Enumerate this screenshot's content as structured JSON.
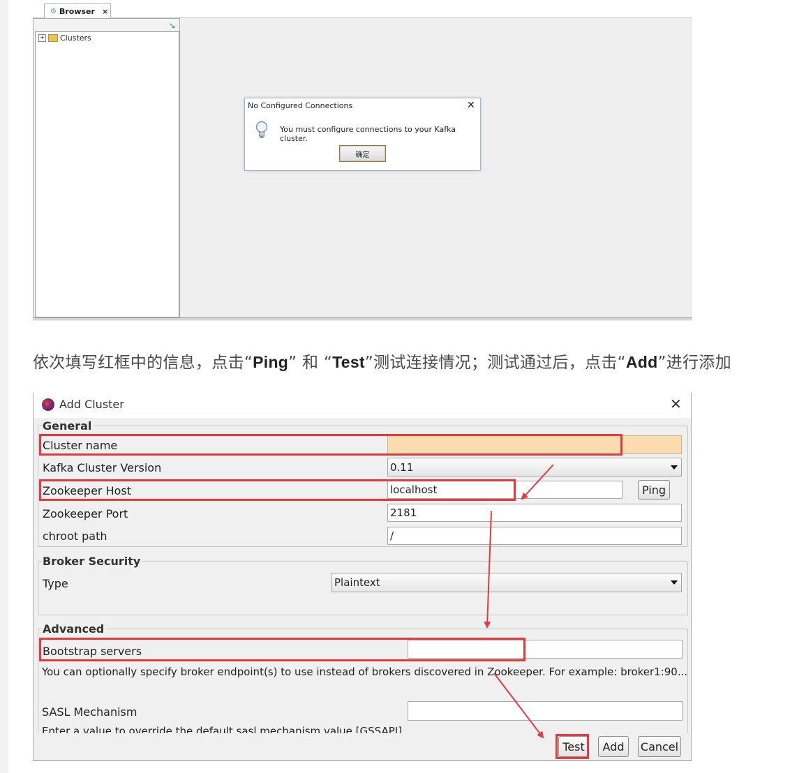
{
  "browser_window": {
    "tab_label": "Browser",
    "tab_close": "×",
    "tree_root": "Clusters",
    "tree_expand": "+",
    "dialog": {
      "title": "No Configured Connections",
      "close": "✕",
      "message": "You must configure connections to your Kafka cluster.",
      "ok_button": "确定"
    }
  },
  "caption": {
    "part1": "依次填写红框中的信息，点击“",
    "ping": "Ping",
    "part2": "” 和 “",
    "test": "Test",
    "part3": "”测试连接情况；测试通过后，点击“",
    "add": "Add",
    "part4": "”进行添加"
  },
  "add_cluster": {
    "title": "Add Cluster",
    "close": "✕",
    "general": {
      "legend": "General",
      "cluster_name_label": "Cluster name",
      "cluster_name_value": "",
      "version_label": "Kafka Cluster Version",
      "version_value": "0.11",
      "zk_host_label": "Zookeeper Host",
      "zk_host_value": "localhost",
      "ping_button": "Ping",
      "zk_port_label": "Zookeeper Port",
      "zk_port_value": "2181",
      "chroot_label": "chroot path",
      "chroot_value": "/"
    },
    "broker_security": {
      "legend": "Broker Security",
      "type_label": "Type",
      "type_value": "Plaintext"
    },
    "advanced": {
      "legend": "Advanced",
      "bootstrap_label": "Bootstrap servers",
      "bootstrap_value": "",
      "bootstrap_hint": "You can optionally specify broker endpoint(s) to use instead of brokers discovered in Zookeeper. For example: broker1:90...",
      "sasl_label": "SASL Mechanism",
      "sasl_value": "",
      "sasl_hint": "Enter a value to override the default sasl mechanism value [GSSAPI]"
    },
    "buttons": {
      "test": "Test",
      "add": "Add",
      "cancel": "Cancel"
    }
  },
  "colors": {
    "highlight": "#e53a40",
    "cluster_name_fill": "#fbdcb0"
  }
}
